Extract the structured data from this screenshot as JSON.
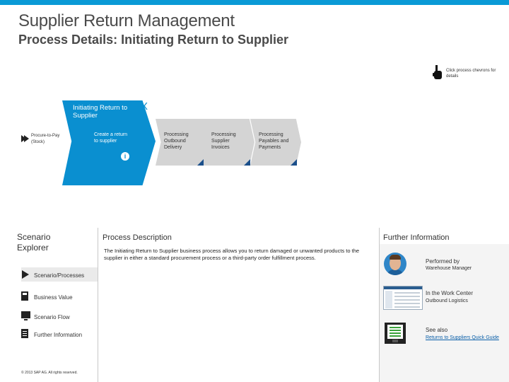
{
  "header": {
    "title": "Supplier Return Management",
    "subtitle": "Process Details: Initiating Return to Supplier"
  },
  "hint": {
    "icon": "hand-pointer-icon",
    "text": "Click process chevrons for details"
  },
  "flow": {
    "title": "Initiating Return to Supplier",
    "close_label": "X",
    "predecessor": "Procure-to-Pay (Stock)",
    "active_step": "Create a return to supplier",
    "info_label": "i",
    "steps": [
      {
        "label": "Processing Outbound Delivery"
      },
      {
        "label": "Processing Supplier Invoices"
      },
      {
        "label": "Processing Payables and Payments"
      }
    ]
  },
  "scenario_explorer": {
    "title": "Scenario Explorer",
    "items": [
      {
        "label": "Scenario/Processes",
        "icon": "process-icon",
        "selected": true
      },
      {
        "label": "Business Value",
        "icon": "calculator-icon"
      },
      {
        "label": "Scenario Flow",
        "icon": "monitor-icon"
      },
      {
        "label": "Further Information",
        "icon": "document-icon"
      }
    ],
    "copyright": "© 2013 SAP AG. All rights reserved."
  },
  "process_description": {
    "title": "Process Description",
    "text": "The Initiating Return to Supplier business process allows you to return damaged or unwanted products to the supplier in either a standard procurement process or a third-party order fulfillment process."
  },
  "further_information": {
    "title": "Further Information",
    "performed_by_label": "Performed by",
    "performed_by_value": "Warehouse Manager",
    "work_center_label": "In the Work Center",
    "work_center_value": "Outbound Logistics",
    "see_also_label": "See also",
    "see_also_link": "Returns to Suppliers Quick Guide"
  },
  "colors": {
    "accent": "#0a9ad6",
    "active_step": "#0a8fd0",
    "inactive_step": "#d4d4d4",
    "corner": "#1b4f8a"
  }
}
